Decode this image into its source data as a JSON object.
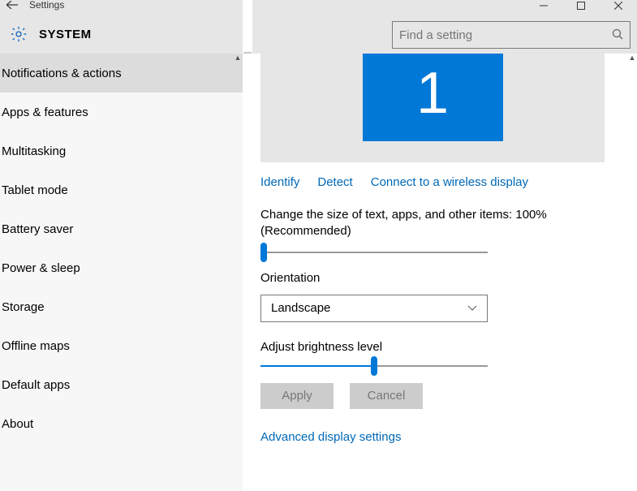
{
  "window": {
    "app_name": "Settings",
    "page": "SYSTEM"
  },
  "search": {
    "placeholder": "Find a setting"
  },
  "sidebar": {
    "selected_index": 0,
    "items": [
      {
        "label": "Notifications & actions"
      },
      {
        "label": "Apps & features"
      },
      {
        "label": "Multitasking"
      },
      {
        "label": "Tablet mode"
      },
      {
        "label": "Battery saver"
      },
      {
        "label": "Power & sleep"
      },
      {
        "label": "Storage"
      },
      {
        "label": "Offline maps"
      },
      {
        "label": "Default apps"
      },
      {
        "label": "About"
      }
    ]
  },
  "display": {
    "monitor_number": "1",
    "links": {
      "identify": "Identify",
      "detect": "Detect",
      "wireless": "Connect to a wireless display"
    },
    "scale_label": "Change the size of text, apps, and other items: 100% (Recommended)",
    "scale_value_percent": 0,
    "orientation_label": "Orientation",
    "orientation_value": "Landscape",
    "brightness_label": "Adjust brightness level",
    "brightness_value_percent": 50,
    "apply_label": "Apply",
    "cancel_label": "Cancel",
    "advanced_link": "Advanced display settings"
  }
}
